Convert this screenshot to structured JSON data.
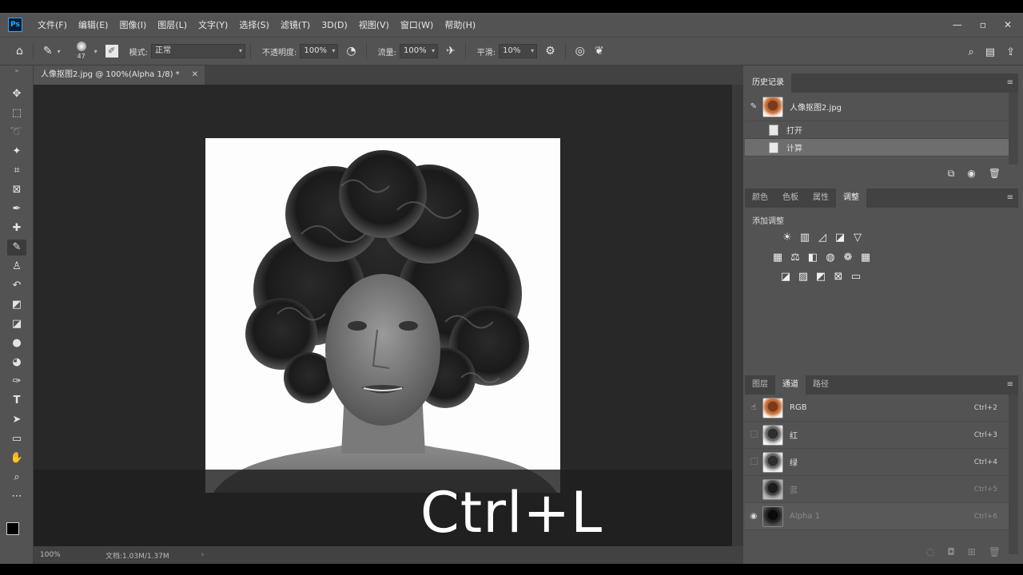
{
  "app": {
    "logo": "Ps",
    "menu": [
      "文件(F)",
      "编辑(E)",
      "图像(I)",
      "图层(L)",
      "文字(Y)",
      "选择(S)",
      "滤镜(T)",
      "3D(D)",
      "视图(V)",
      "窗口(W)",
      "帮助(H)"
    ],
    "window_controls": [
      "minimize-icon",
      "restore-icon",
      "close-icon"
    ]
  },
  "options": {
    "brush_size": "47",
    "mode_label": "模式:",
    "mode_value": "正常",
    "opacity_label": "不透明度:",
    "opacity_value": "100%",
    "flow_label": "流量:",
    "flow_value": "100%",
    "smoothing_label": "平滑:",
    "smoothing_value": "10%"
  },
  "document": {
    "tab_title": "人像抠图2.jpg @ 100%(Alpha 1/8) *",
    "zoom": "100%",
    "doc_info": "文档:1.03M/1.37M"
  },
  "history": {
    "tab": "历史记录",
    "snapshot": "人像抠图2.jpg",
    "items": [
      "打开",
      "计算"
    ]
  },
  "adjust_panel": {
    "tabs": [
      "颜色",
      "色板",
      "属性",
      "调整"
    ],
    "active_tab": "调整",
    "title": "添加调整"
  },
  "layers_panel": {
    "tabs": [
      "图层",
      "通道",
      "路径"
    ],
    "active_tab": "通道",
    "channels": [
      {
        "name": "RGB",
        "shortcut": "Ctrl+2"
      },
      {
        "name": "红",
        "shortcut": "Ctrl+3"
      },
      {
        "name": "绿",
        "shortcut": "Ctrl+4"
      },
      {
        "name": "蓝",
        "shortcut": "Ctrl+5"
      },
      {
        "name": "Alpha 1",
        "shortcut": "Ctrl+6"
      }
    ]
  },
  "overlay": {
    "caption": "Ctrl+L"
  }
}
